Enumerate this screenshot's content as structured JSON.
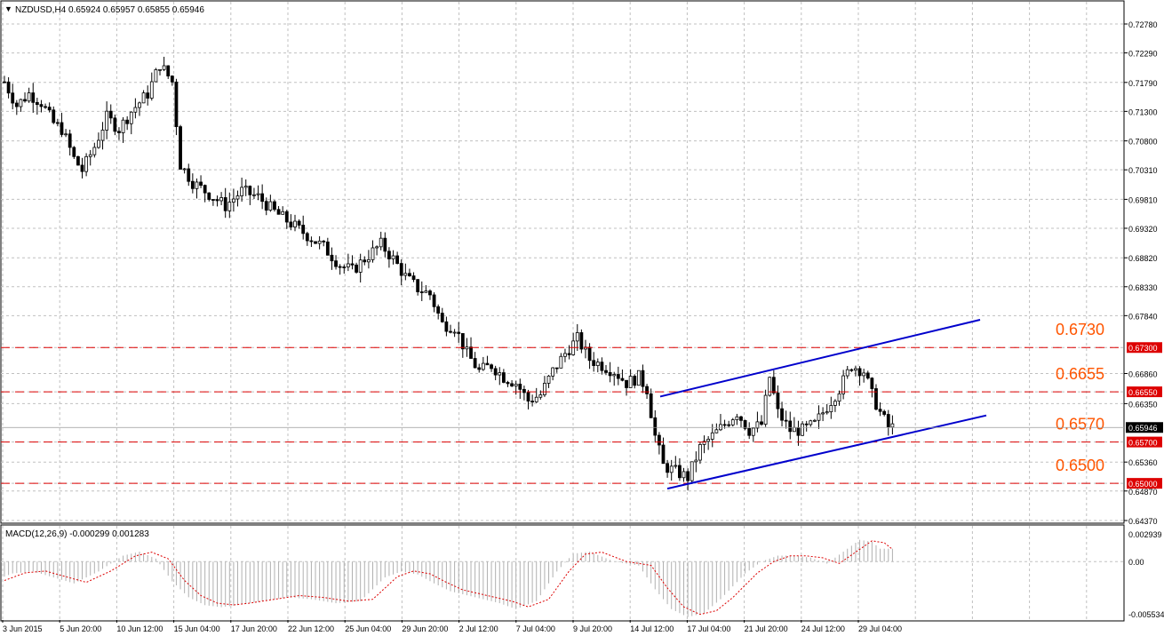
{
  "header": {
    "title": "NZDUSD,H4  0.65924 0.65957 0.65855 0.65946"
  },
  "macd_header": {
    "title": "MACD(12,26,9) -0.000299 0.001283"
  },
  "colors": {
    "background": "#ffffff",
    "grid": "#c0c0c0",
    "candle": "#000000",
    "channel": "#0000cc",
    "level": "#dd0000",
    "level_label": "#ff5500",
    "macd_signal": "#dd0000",
    "macd_hist": "#b0b0b0"
  },
  "chart_data": [
    {
      "type": "candlestick",
      "symbol": "NZDUSD",
      "timeframe": "H4",
      "ohlc_current": {
        "open": 0.65924,
        "high": 0.65957,
        "low": 0.65855,
        "close": 0.65946
      },
      "current_price_label": "0.65946",
      "ylim": [
        0.6437,
        0.7278
      ],
      "y_ticks": [
        "0.72780",
        "0.72290",
        "0.71790",
        "0.71300",
        "0.70800",
        "0.70310",
        "0.69810",
        "0.69320",
        "0.68820",
        "0.68330",
        "0.67840",
        "0.67300",
        "0.66860",
        "0.66550",
        "0.66350",
        "0.65700",
        "0.65360",
        "0.65000",
        "0.64870",
        "0.64370"
      ],
      "x_ticks": [
        "3 Jun 2015",
        "5 Jun 20:00",
        "10 Jun 12:00",
        "15 Jun 04:00",
        "17 Jun 20:00",
        "22 Jun 12:00",
        "25 Jun 04:00",
        "29 Jun 20:00",
        "2 Jul 12:00",
        "7 Jul 04:00",
        "9 Jul 20:00",
        "14 Jul 12:00",
        "17 Jul 04:00",
        "21 Jul 20:00",
        "24 Jul 12:00",
        "29 Jul 04:00"
      ],
      "close_path": [
        [
          0,
          0.718
        ],
        [
          3,
          0.714
        ],
        [
          6,
          0.716
        ],
        [
          9,
          0.7145
        ],
        [
          12,
          0.711
        ],
        [
          14,
          0.71
        ],
        [
          17,
          0.705
        ],
        [
          19,
          0.703
        ],
        [
          22,
          0.707
        ],
        [
          25,
          0.712
        ],
        [
          28,
          0.71
        ],
        [
          31,
          0.713
        ],
        [
          35,
          0.716
        ],
        [
          38,
          0.721
        ],
        [
          41,
          0.718
        ],
        [
          43,
          0.704
        ],
        [
          46,
          0.701
        ],
        [
          50,
          0.699
        ],
        [
          54,
          0.697
        ],
        [
          58,
          0.6995
        ],
        [
          62,
          0.6985
        ],
        [
          66,
          0.696
        ],
        [
          70,
          0.694
        ],
        [
          74,
          0.692
        ],
        [
          78,
          0.69
        ],
        [
          82,
          0.687
        ],
        [
          85,
          0.686
        ],
        [
          88,
          0.688
        ],
        [
          92,
          0.6905
        ],
        [
          95,
          0.688
        ],
        [
          98,
          0.685
        ],
        [
          101,
          0.683
        ],
        [
          104,
          0.682
        ],
        [
          107,
          0.677
        ],
        [
          110,
          0.6765
        ],
        [
          113,
          0.672
        ],
        [
          116,
          0.669
        ],
        [
          119,
          0.67
        ],
        [
          122,
          0.668
        ],
        [
          125,
          0.667
        ],
        [
          128,
          0.664
        ],
        [
          131,
          0.665
        ],
        [
          134,
          0.669
        ],
        [
          137,
          0.672
        ],
        [
          140,
          0.6745
        ],
        [
          143,
          0.671
        ],
        [
          146,
          0.67
        ],
        [
          149,
          0.669
        ],
        [
          152,
          0.667
        ],
        [
          155,
          0.668
        ],
        [
          157,
          0.666
        ],
        [
          159,
          0.658
        ],
        [
          161,
          0.653
        ],
        [
          164,
          0.652
        ],
        [
          167,
          0.651
        ],
        [
          170,
          0.656
        ],
        [
          173,
          0.658
        ],
        [
          176,
          0.66
        ],
        [
          179,
          0.662
        ],
        [
          182,
          0.659
        ],
        [
          185,
          0.66
        ],
        [
          187,
          0.668
        ],
        [
          189,
          0.662
        ],
        [
          192,
          0.659
        ],
        [
          195,
          0.659
        ],
        [
          198,
          0.66
        ],
        [
          201,
          0.663
        ],
        [
          204,
          0.666
        ],
        [
          207,
          0.67
        ],
        [
          210,
          0.669
        ],
        [
          212,
          0.665
        ],
        [
          214,
          0.662
        ],
        [
          216,
          0.6595
        ]
      ],
      "horizontal_levels": [
        {
          "value": 0.673,
          "label": "0.6730",
          "axis_label": "0.67300"
        },
        {
          "value": 0.6655,
          "label": "0.6655",
          "axis_label": "0.66550"
        },
        {
          "value": 0.657,
          "label": "0.6570",
          "axis_label": "0.65700"
        },
        {
          "value": 0.65,
          "label": "0.6500",
          "axis_label": "0.65000"
        }
      ],
      "channel_lines": [
        {
          "name": "upper",
          "start": [
            0.6647,
            "14 Jul 12:00"
          ],
          "end": [
            0.6777,
            "past 29 Jul 04:00"
          ]
        },
        {
          "name": "lower",
          "start": [
            0.6491,
            "14 Jul 12:00"
          ],
          "end": [
            0.6615,
            "past 29 Jul 04:00"
          ]
        }
      ]
    },
    {
      "type": "macd",
      "params": "MACD(12,26,9)",
      "main": -0.000299,
      "signal": 0.001283,
      "ylim": [
        -0.005534,
        0.002939
      ],
      "y_ticks": [
        "0.002939",
        "0.00",
        "-0.005534"
      ],
      "signal_path": [
        [
          0,
          -0.002
        ],
        [
          5,
          -0.0012
        ],
        [
          10,
          -0.001
        ],
        [
          15,
          -0.0016
        ],
        [
          20,
          -0.0022
        ],
        [
          26,
          -0.001
        ],
        [
          32,
          0.0006
        ],
        [
          36,
          0.001
        ],
        [
          40,
          0.0003
        ],
        [
          44,
          -0.002
        ],
        [
          48,
          -0.0036
        ],
        [
          52,
          -0.0044
        ],
        [
          56,
          -0.0046
        ],
        [
          60,
          -0.0044
        ],
        [
          66,
          -0.004
        ],
        [
          72,
          -0.0036
        ],
        [
          78,
          -0.0038
        ],
        [
          84,
          -0.0042
        ],
        [
          90,
          -0.004
        ],
        [
          96,
          -0.0016
        ],
        [
          100,
          -0.001
        ],
        [
          104,
          -0.0013
        ],
        [
          108,
          -0.0022
        ],
        [
          112,
          -0.003
        ],
        [
          118,
          -0.0036
        ],
        [
          124,
          -0.0042
        ],
        [
          128,
          -0.0048
        ],
        [
          133,
          -0.004
        ],
        [
          138,
          -0.001
        ],
        [
          142,
          0.0008
        ],
        [
          146,
          0.001
        ],
        [
          152,
          0.0
        ],
        [
          158,
          -0.0004
        ],
        [
          162,
          -0.0028
        ],
        [
          166,
          -0.0048
        ],
        [
          170,
          -0.0056
        ],
        [
          174,
          -0.0052
        ],
        [
          178,
          -0.0038
        ],
        [
          184,
          -0.0012
        ],
        [
          188,
          0.0
        ],
        [
          192,
          0.0006
        ],
        [
          196,
          0.0006
        ],
        [
          200,
          0.0004
        ],
        [
          204,
          -0.0002
        ],
        [
          208,
          0.001
        ],
        [
          212,
          0.0022
        ],
        [
          215,
          0.002
        ],
        [
          217,
          0.0013
        ]
      ]
    }
  ]
}
